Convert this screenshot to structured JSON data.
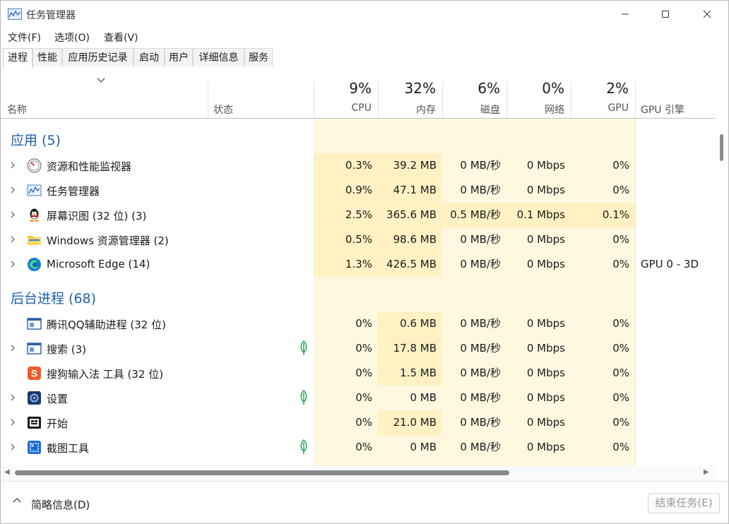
{
  "window": {
    "title": "任务管理器"
  },
  "menu": [
    {
      "label": "文件(F)"
    },
    {
      "label": "选项(O)"
    },
    {
      "label": "查看(V)"
    }
  ],
  "tabs": [
    {
      "label": "进程",
      "active": true
    },
    {
      "label": "性能"
    },
    {
      "label": "应用历史记录"
    },
    {
      "label": "启动"
    },
    {
      "label": "用户"
    },
    {
      "label": "详细信息"
    },
    {
      "label": "服务"
    }
  ],
  "columns": {
    "name": "名称",
    "status": "状态",
    "cpu": {
      "pct": "9%",
      "label": "CPU"
    },
    "mem": {
      "pct": "32%",
      "label": "内存"
    },
    "disk": {
      "pct": "6%",
      "label": "磁盘"
    },
    "net": {
      "pct": "0%",
      "label": "网络"
    },
    "gpu": {
      "pct": "2%",
      "label": "GPU"
    },
    "gpu_engine": "GPU 引擎"
  },
  "groups": [
    {
      "label": "应用 (5)",
      "rows": [
        {
          "name": "资源和性能监视器",
          "icon": "resource-monitor-icon",
          "expandable": true,
          "cpu": "0.3%",
          "mem": "39.2 MB",
          "disk": "0 MB/秒",
          "net": "0 Mbps",
          "gpu": "0%",
          "gpu_engine": ""
        },
        {
          "name": "任务管理器",
          "icon": "task-manager-icon",
          "expandable": true,
          "cpu": "0.9%",
          "mem": "47.1 MB",
          "disk": "0 MB/秒",
          "net": "0 Mbps",
          "gpu": "0%",
          "gpu_engine": ""
        },
        {
          "name": "屏幕识图 (32 位) (3)",
          "icon": "qq-penguin-icon",
          "expandable": true,
          "cpu": "2.5%",
          "mem": "365.6 MB",
          "disk": "0.5 MB/秒",
          "net": "0.1 Mbps",
          "gpu": "0.1%",
          "gpu_engine": ""
        },
        {
          "name": "Windows 资源管理器 (2)",
          "icon": "folder-icon",
          "expandable": true,
          "cpu": "0.5%",
          "mem": "98.6 MB",
          "disk": "0 MB/秒",
          "net": "0 Mbps",
          "gpu": "0%",
          "gpu_engine": ""
        },
        {
          "name": "Microsoft Edge (14)",
          "icon": "edge-icon",
          "expandable": true,
          "cpu": "1.3%",
          "mem": "426.5 MB",
          "disk": "0 MB/秒",
          "net": "0 Mbps",
          "gpu": "0%",
          "gpu_engine": "GPU 0 - 3D"
        }
      ]
    },
    {
      "label": "后台进程 (68)",
      "rows": [
        {
          "name": "腾讯QQ辅助进程 (32 位)",
          "icon": "app-window-icon",
          "expandable": false,
          "cpu": "0%",
          "mem": "0.6 MB",
          "disk": "0 MB/秒",
          "net": "0 Mbps",
          "gpu": "0%",
          "gpu_engine": ""
        },
        {
          "name": "搜索 (3)",
          "icon": "search-app-icon",
          "expandable": true,
          "suspended": true,
          "cpu": "0%",
          "mem": "17.8 MB",
          "disk": "0 MB/秒",
          "net": "0 Mbps",
          "gpu": "0%",
          "gpu_engine": ""
        },
        {
          "name": "搜狗输入法 工具 (32 位)",
          "icon": "sogou-icon",
          "expandable": false,
          "cpu": "0%",
          "mem": "1.5 MB",
          "disk": "0 MB/秒",
          "net": "0 Mbps",
          "gpu": "0%",
          "gpu_engine": ""
        },
        {
          "name": "设置",
          "icon": "settings-icon",
          "expandable": true,
          "suspended": true,
          "cpu": "0%",
          "mem": "0 MB",
          "disk": "0 MB/秒",
          "net": "0 Mbps",
          "gpu": "0%",
          "gpu_engine": ""
        },
        {
          "name": "开始",
          "icon": "start-icon",
          "expandable": true,
          "cpu": "0%",
          "mem": "21.0 MB",
          "disk": "0 MB/秒",
          "net": "0 Mbps",
          "gpu": "0%",
          "gpu_engine": ""
        },
        {
          "name": "截图工具",
          "icon": "snipping-tool-icon",
          "expandable": true,
          "suspended": true,
          "cpu": "0%",
          "mem": "0 MB",
          "disk": "0 MB/秒",
          "net": "0 Mbps",
          "gpu": "0%",
          "gpu_engine": ""
        }
      ]
    }
  ],
  "footer": {
    "fewer_details": "简略信息(D)",
    "end_task": "结束任务(E)"
  }
}
